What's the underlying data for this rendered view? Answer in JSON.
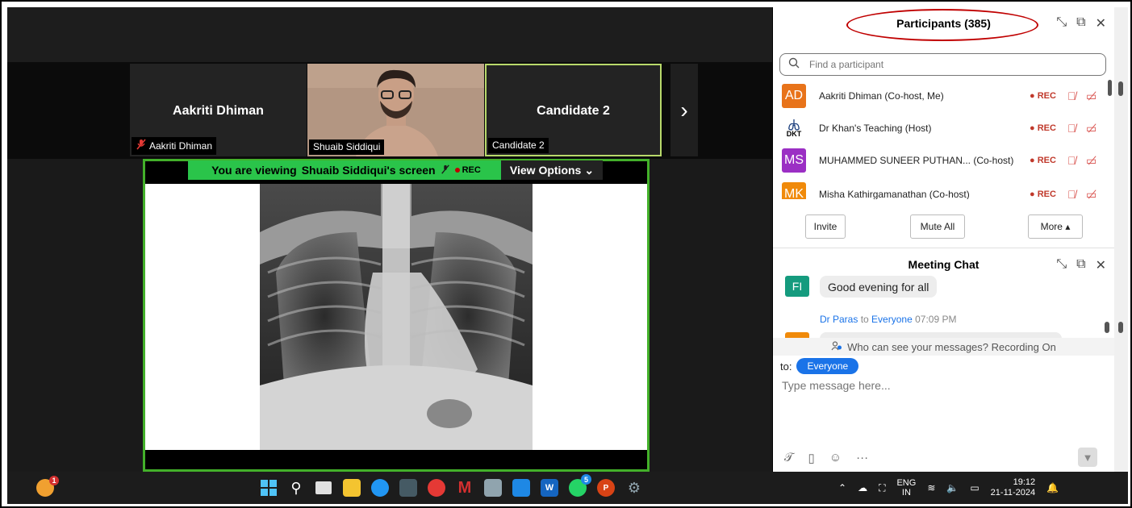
{
  "thumbnails": [
    {
      "name": "Aakriti Dhiman",
      "label": "Aakriti Dhiman",
      "muted": true
    },
    {
      "name": "",
      "label": "Shuaib Siddiqui",
      "muted": false
    },
    {
      "name": "Candidate 2",
      "label": "Candidate 2",
      "muted": false
    }
  ],
  "share": {
    "banner_prefix": "You are viewing",
    "banner_name": "Shuaib Siddiqui's screen",
    "rec": "REC",
    "view_options": "View Options",
    "marker": "L"
  },
  "participants": {
    "title": "Participants (385)",
    "search_placeholder": "Find a participant",
    "rows": [
      {
        "initials": "AD",
        "color": "#e8731a",
        "name": "Aakriti Dhiman (Co-host, Me)",
        "rec": "REC"
      },
      {
        "initials": "DKT",
        "color": "#ffffff",
        "name": "Dr Khan's Teaching (Host)",
        "rec": "REC"
      },
      {
        "initials": "MS",
        "color": "#9b2fc4",
        "name": "MUHAMMED SUNEER PUTHAN... (Co-host)",
        "rec": "REC"
      },
      {
        "initials": "MK",
        "color": "#f08a0a",
        "name": "Misha Kathirgamanathan (Co-host)",
        "rec": "REC"
      }
    ],
    "invite": "Invite",
    "mute_all": "Mute All",
    "more": "More"
  },
  "chat": {
    "title": "Meeting Chat",
    "messages": [
      {
        "initials": "FI",
        "text": "Good evening for all"
      }
    ],
    "meta_sender": "Dr Paras",
    "meta_to": "to",
    "meta_recipient": "Everyone",
    "meta_time": "07:09 PM",
    "visibility": "Who can see your messages? Recording On",
    "to_label": "to:",
    "to_value": "Everyone",
    "input_placeholder": "Type message here..."
  },
  "taskbar": {
    "lang_top": "ENG",
    "lang_bottom": "IN",
    "time": "19:12",
    "date": "21-11-2024",
    "badge_weather": "1",
    "badge_whatsapp": "5"
  }
}
